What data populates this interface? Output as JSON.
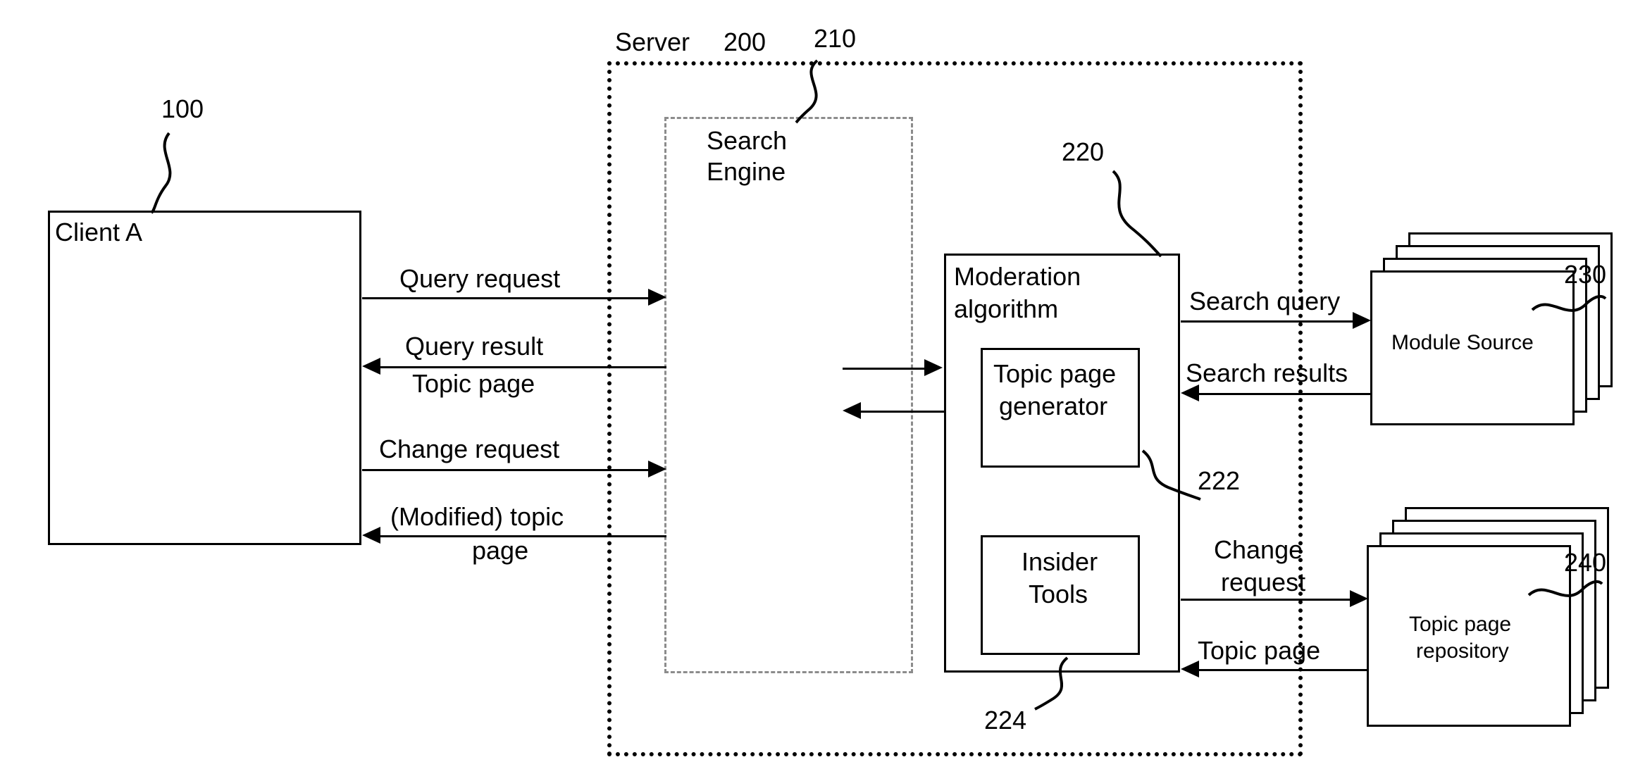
{
  "refs": {
    "client": "100",
    "server_label": "Server",
    "server_num": "200",
    "search_engine": "210",
    "moderation": "220",
    "topic_gen": "222",
    "insider_tools": "224",
    "module_source": "230",
    "topic_repo": "240"
  },
  "nodes": {
    "client_a": "Client A",
    "search_engine_l1": "Search",
    "search_engine_l2": "Engine",
    "moderation_l1": "Moderation",
    "moderation_l2": "algorithm",
    "topic_gen_l1": "Topic page",
    "topic_gen_l2": "generator",
    "insider_l1": "Insider",
    "insider_l2": "Tools",
    "module_source": "Module Source",
    "topic_repo_l1": "Topic page",
    "topic_repo_l2": "repository"
  },
  "edges": {
    "query_request": "Query request",
    "query_result": "Query result",
    "topic_page_under_query": "Topic page",
    "change_request_client": "Change request",
    "modified_topic_page_l1": "(Modified) topic",
    "modified_topic_page_l2": "page",
    "search_query": "Search query",
    "search_results": "Search results",
    "change_request_repo_l1": "Change",
    "change_request_repo_l2": "request",
    "topic_page_from_repo": "Topic page"
  }
}
